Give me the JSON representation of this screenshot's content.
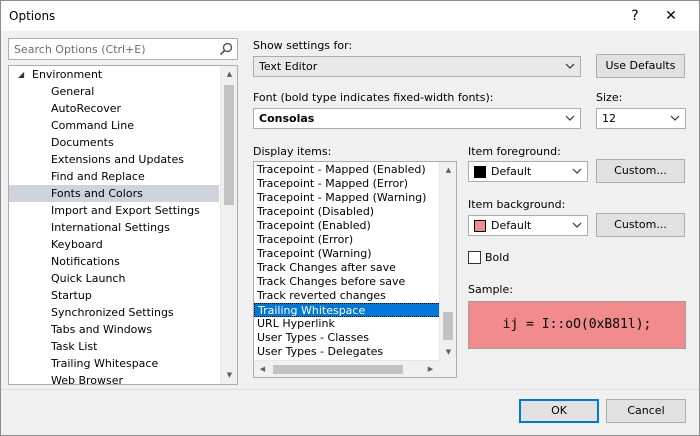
{
  "window": {
    "title": "Options",
    "help_glyph": "?",
    "close_glyph": "✕"
  },
  "search": {
    "placeholder": "Search Options (Ctrl+E)"
  },
  "tree": {
    "root": "Environment",
    "items": [
      "General",
      "AutoRecover",
      "Command Line",
      "Documents",
      "Extensions and Updates",
      "Find and Replace",
      "Fonts and Colors",
      "Import and Export Settings",
      "International Settings",
      "Keyboard",
      "Notifications",
      "Quick Launch",
      "Startup",
      "Synchronized Settings",
      "Tabs and Windows",
      "Task List",
      "Trailing Whitespace",
      "Web Browser"
    ],
    "selected": "Fonts and Colors"
  },
  "settings": {
    "show_label": "Show settings for:",
    "show_value": "Text Editor",
    "use_defaults_label": "Use Defaults",
    "font_label": "Font (bold type indicates fixed-width fonts):",
    "font_value": "Consolas",
    "size_label": "Size:",
    "size_value": "12"
  },
  "display_items": {
    "label": "Display items:",
    "items": [
      "Tracepoint - Mapped (Enabled)",
      "Tracepoint - Mapped (Error)",
      "Tracepoint - Mapped (Warning)",
      "Tracepoint (Disabled)",
      "Tracepoint (Enabled)",
      "Tracepoint (Error)",
      "Tracepoint (Warning)",
      "Track Changes after save",
      "Track Changes before save",
      "Track reverted changes",
      "Trailing Whitespace",
      "URL Hyperlink",
      "User Types - Classes",
      "User Types - Delegates"
    ],
    "selected": "Trailing Whitespace"
  },
  "foreground": {
    "label": "Item foreground:",
    "value": "Default",
    "swatch_color": "#000000",
    "custom_label": "Custom..."
  },
  "background": {
    "label": "Item background:",
    "value": "Default",
    "swatch_color": "#f28b8b",
    "custom_label": "Custom..."
  },
  "bold": {
    "label": "Bold",
    "checked": false
  },
  "sample": {
    "label": "Sample:",
    "text": "ij = I::oO(0xB81l);",
    "background": "#f28b8b"
  },
  "footer": {
    "ok_label": "OK",
    "cancel_label": "Cancel"
  }
}
